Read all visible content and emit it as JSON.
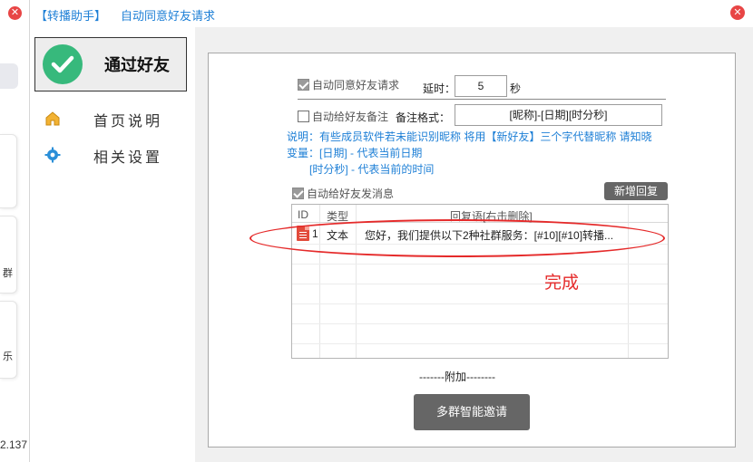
{
  "background_app": {
    "card_texts": [
      "群",
      "乐"
    ],
    "version": "2.137"
  },
  "window": {
    "app_name": "【转播助手】",
    "title": "自动同意好友请求"
  },
  "sidebar": {
    "primary_button": "通过好友",
    "items": [
      {
        "label": "首页说明",
        "icon": "home-icon"
      },
      {
        "label": "相关设置",
        "icon": "gear-icon"
      }
    ]
  },
  "settings": {
    "auto_accept": {
      "label": "自动同意好友请求",
      "checked": true
    },
    "delay": {
      "label": "延时：",
      "value": "5",
      "unit": "秒"
    },
    "auto_remark": {
      "label": "自动给好友备注",
      "checked": false
    },
    "remark_format": {
      "label": "备注格式：",
      "value": "[昵称]-[日期][时分秒]"
    },
    "notes": [
      "说明：有些成员软件若未能识别昵称 将用【新好友】三个字代替昵称 请知晓",
      "变量：[日期] - 代表当前日期",
      "[时分秒] - 代表当前的时间"
    ],
    "auto_message": {
      "label": "自动给好友发消息",
      "checked": true
    },
    "add_reply_label": "新增回复"
  },
  "reply_table": {
    "columns": [
      "ID",
      "类型",
      "回复语[右击删除]"
    ],
    "rows": [
      {
        "id": "1",
        "type": "文本",
        "content": "您好，我们提供以下2种社群服务：[#10][#10]转播..."
      }
    ]
  },
  "annotation": {
    "text": "完成",
    "color": "#e52a2a"
  },
  "footer": {
    "addon_label": "-------附加--------",
    "multi_invite_label": "多群智能邀请"
  },
  "colors": {
    "accent": "#1d7fd6",
    "check_green": "#37b97c",
    "button_gray": "#666666",
    "close_red": "#e84545"
  }
}
